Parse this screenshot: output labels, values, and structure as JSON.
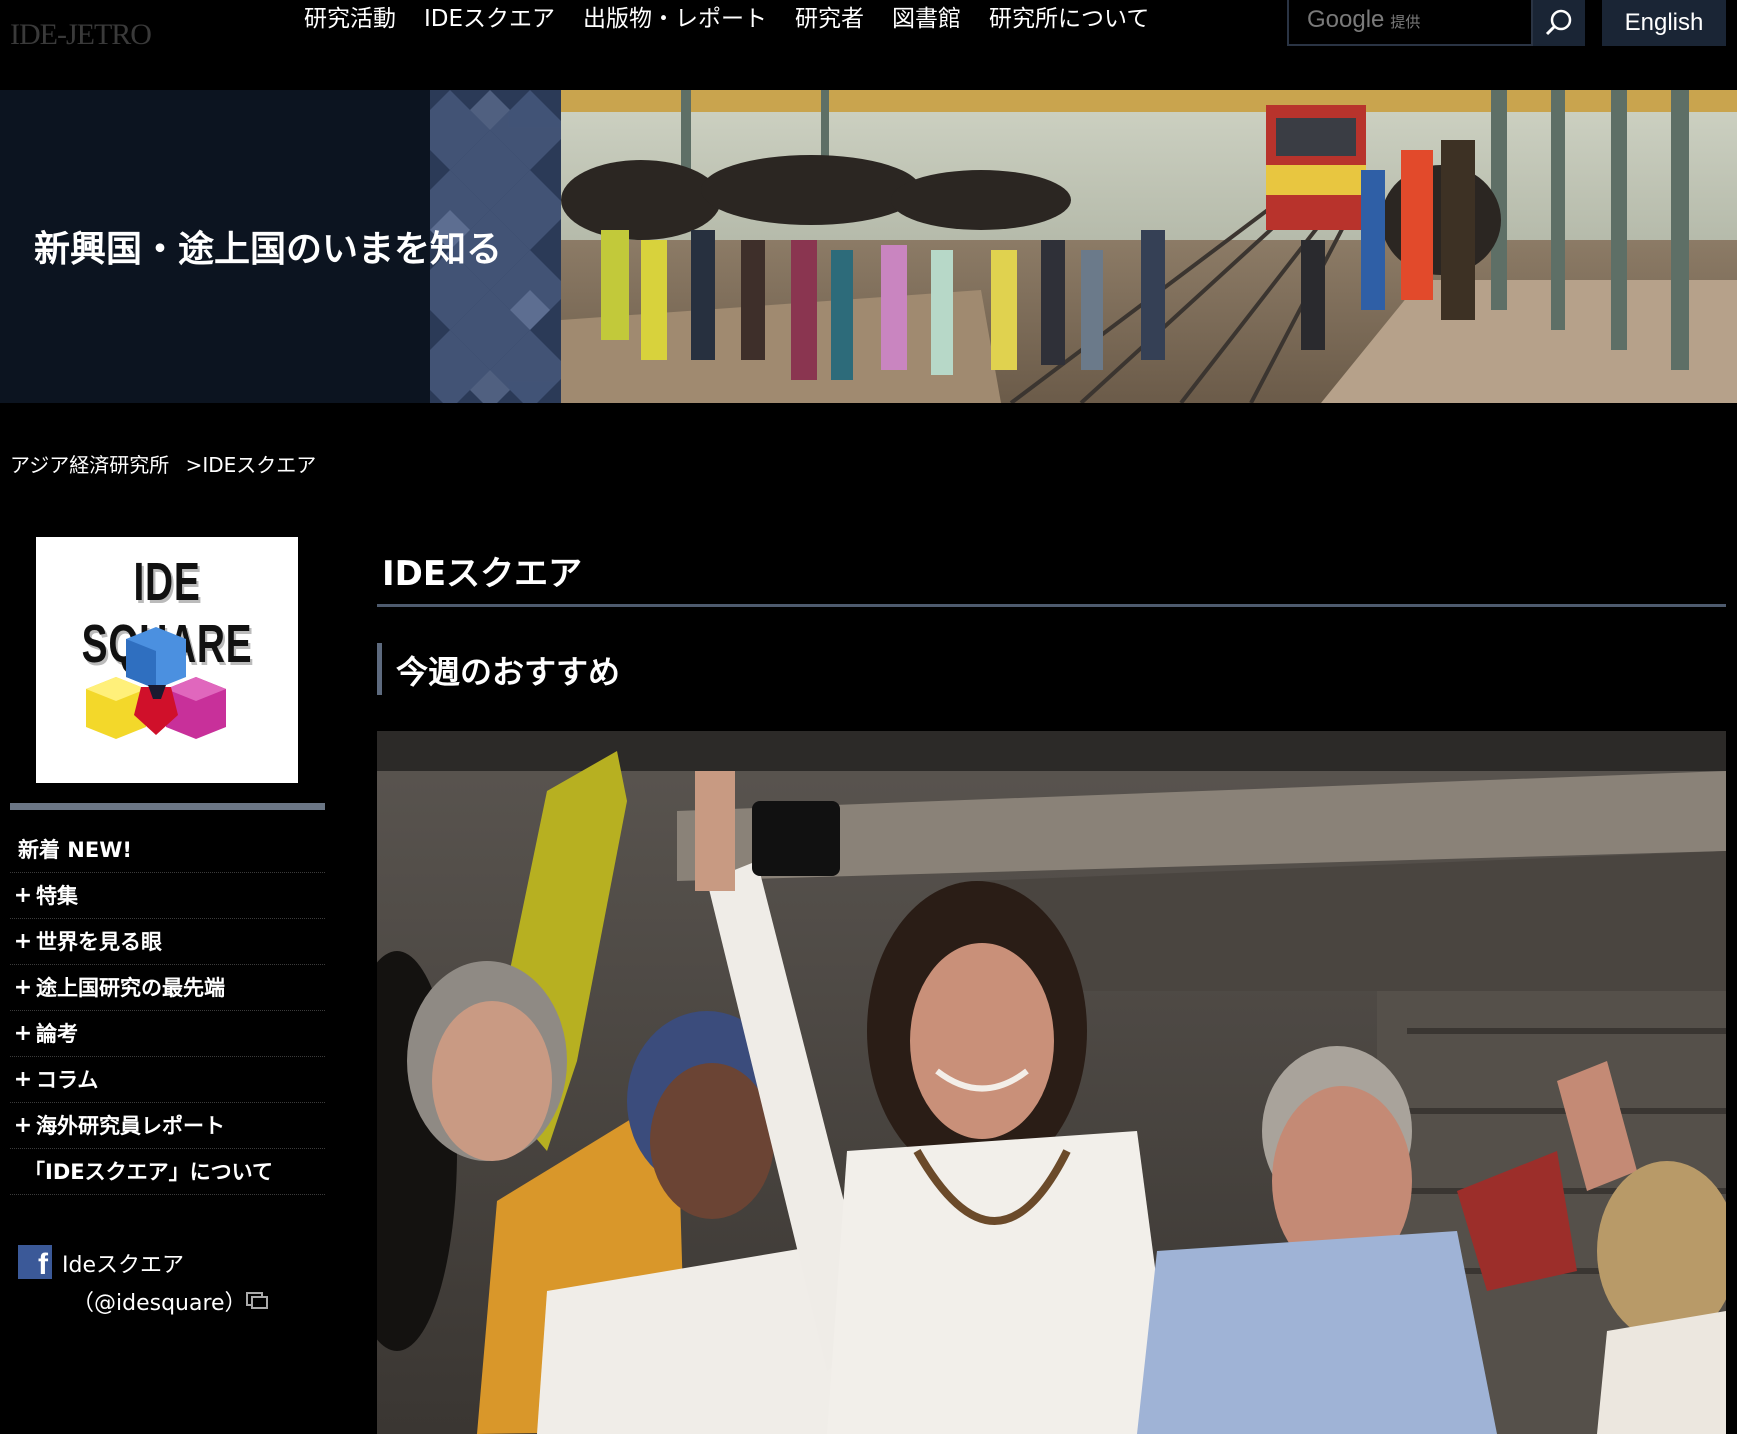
{
  "header": {
    "logo": "IDE-JETRO",
    "nav": [
      "研究活動",
      "IDEスクエア",
      "出版物・レポート",
      "研究者",
      "図書館",
      "研究所について"
    ],
    "search": {
      "placeholder": "Google",
      "provider_note": "提供"
    },
    "english_label": "English"
  },
  "hero": {
    "title": "新興国・途上国のいまを知る",
    "colors": {
      "panel": "#0c1420",
      "pattern": "#2e3e5c"
    }
  },
  "breadcrumb": [
    "アジア経済研究所",
    ">IDEスクエア"
  ],
  "sidebar": {
    "logo_text": "IDE SQUARE",
    "menu": [
      {
        "label": "新着 NEW!",
        "plus": false
      },
      {
        "label": "特集",
        "plus": true
      },
      {
        "label": "世界を見る眼",
        "plus": true
      },
      {
        "label": "途上国研究の最先端",
        "plus": true
      },
      {
        "label": "論考",
        "plus": true
      },
      {
        "label": "コラム",
        "plus": true
      },
      {
        "label": "海外研究員レポート",
        "plus": true
      },
      {
        "label": "「IDEスクエア」について",
        "plus": false
      }
    ],
    "facebook": {
      "name": "Ideスクエア",
      "handle": "（@idesquare）"
    }
  },
  "main": {
    "title": "IDEスクエア",
    "section_title": "今週のおすすめ"
  }
}
